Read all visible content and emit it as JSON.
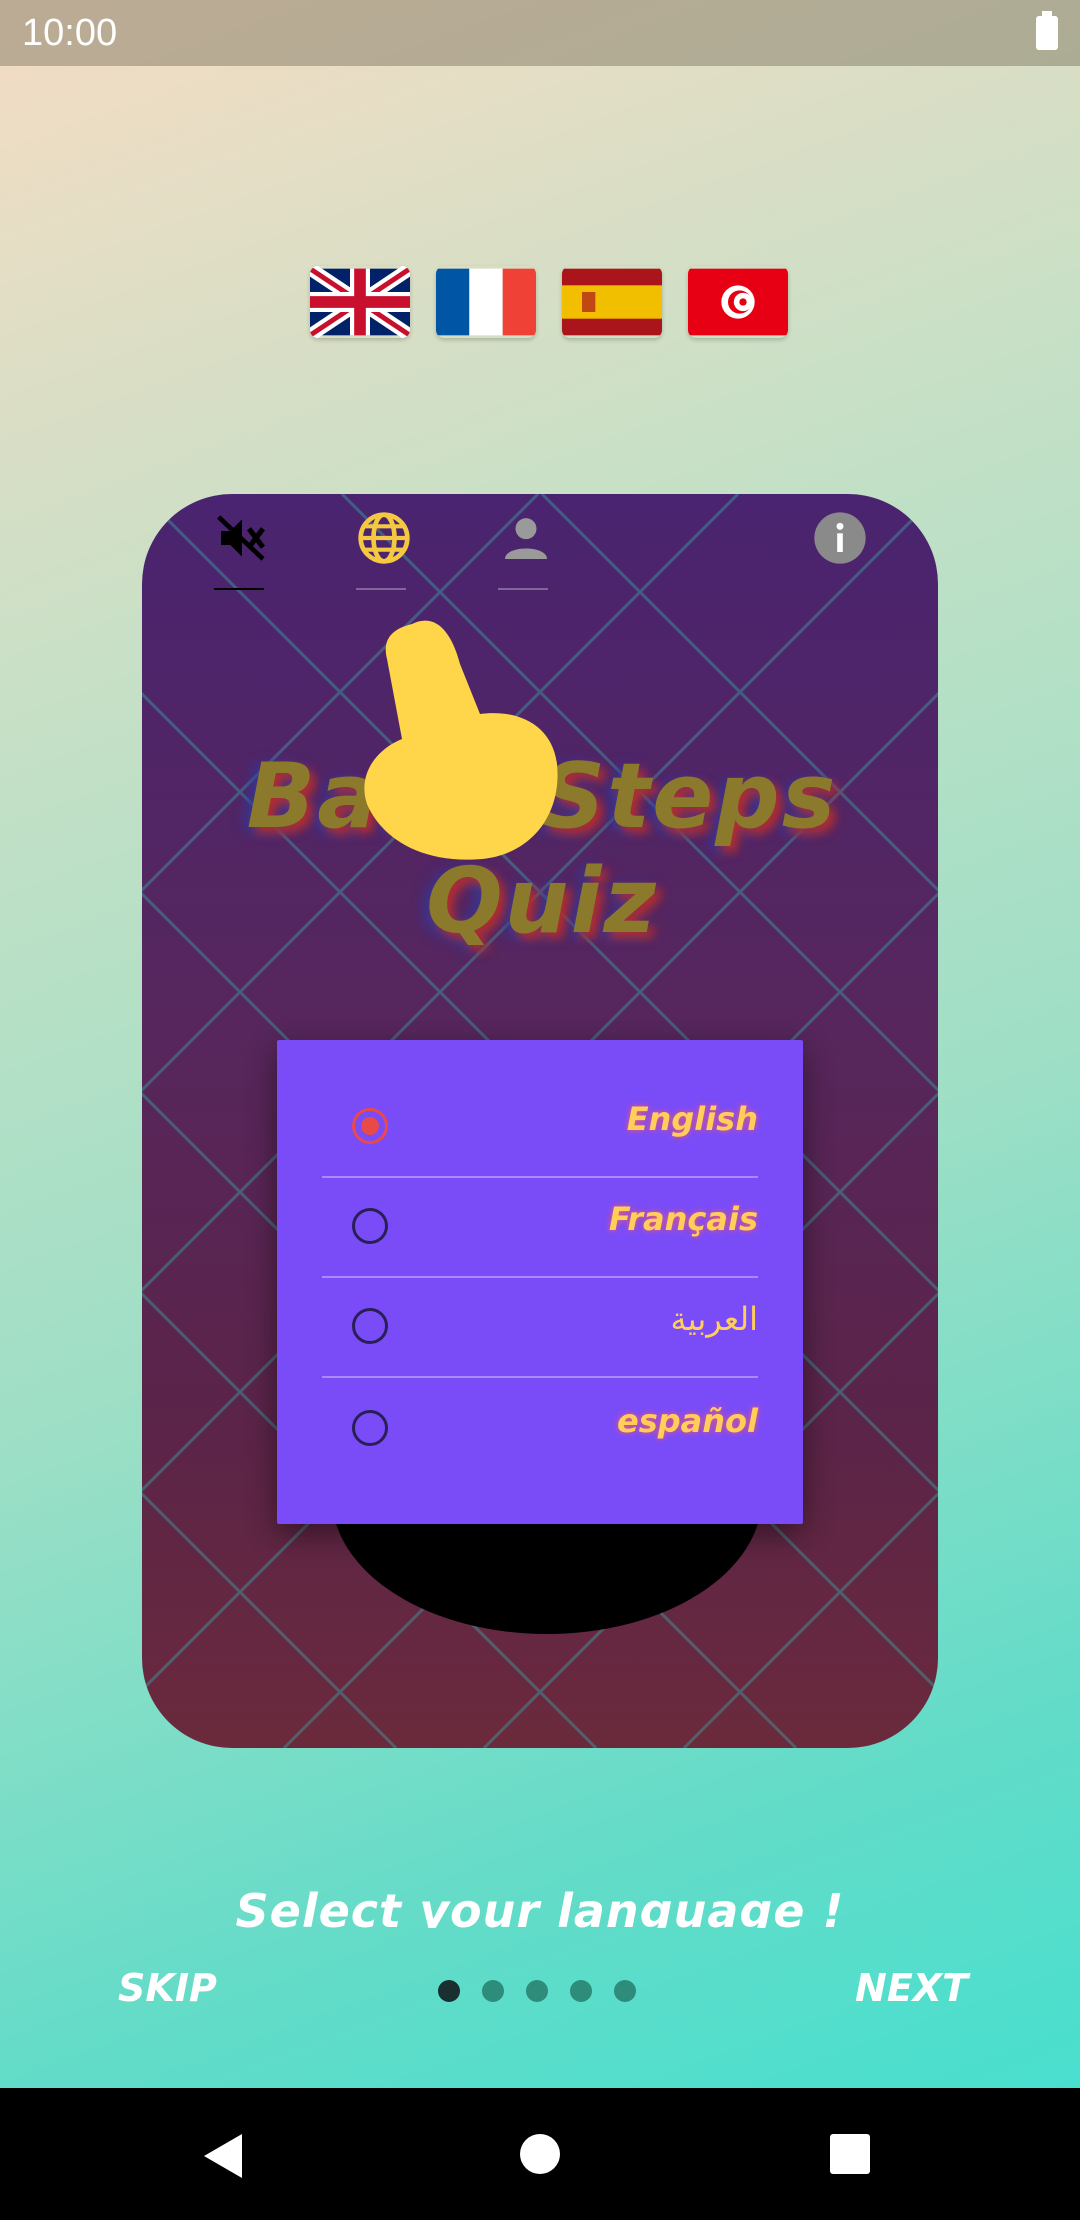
{
  "status_bar": {
    "time": "10:00",
    "battery_icon": "battery-full-icon"
  },
  "flags": [
    {
      "name": "uk-flag",
      "language": "English"
    },
    {
      "name": "france-flag",
      "language": "Français"
    },
    {
      "name": "spain-flag",
      "language": "español"
    },
    {
      "name": "tunisia-flag",
      "language": "العربية"
    }
  ],
  "card": {
    "logo_text": "Baby Steps Quiz",
    "top_icons": [
      "sound-off-icon",
      "globe-icon",
      "person-icon",
      "info-icon"
    ]
  },
  "language_dialog": {
    "options": [
      {
        "label": "English",
        "checked": true
      },
      {
        "label": "Français",
        "checked": false
      },
      {
        "label": "العربية",
        "checked": false
      },
      {
        "label": "español",
        "checked": false
      }
    ]
  },
  "onboarding": {
    "caption": "Select your language !",
    "skip_label": "SKIP",
    "next_label": "NEXT",
    "page_count": 5,
    "current_page": 1
  },
  "colors": {
    "dialog_bg": "#7a4cf8",
    "label_color": "#ffcf5a",
    "radio_checked": "#e84a4a",
    "globe_active": "#f5c842"
  }
}
